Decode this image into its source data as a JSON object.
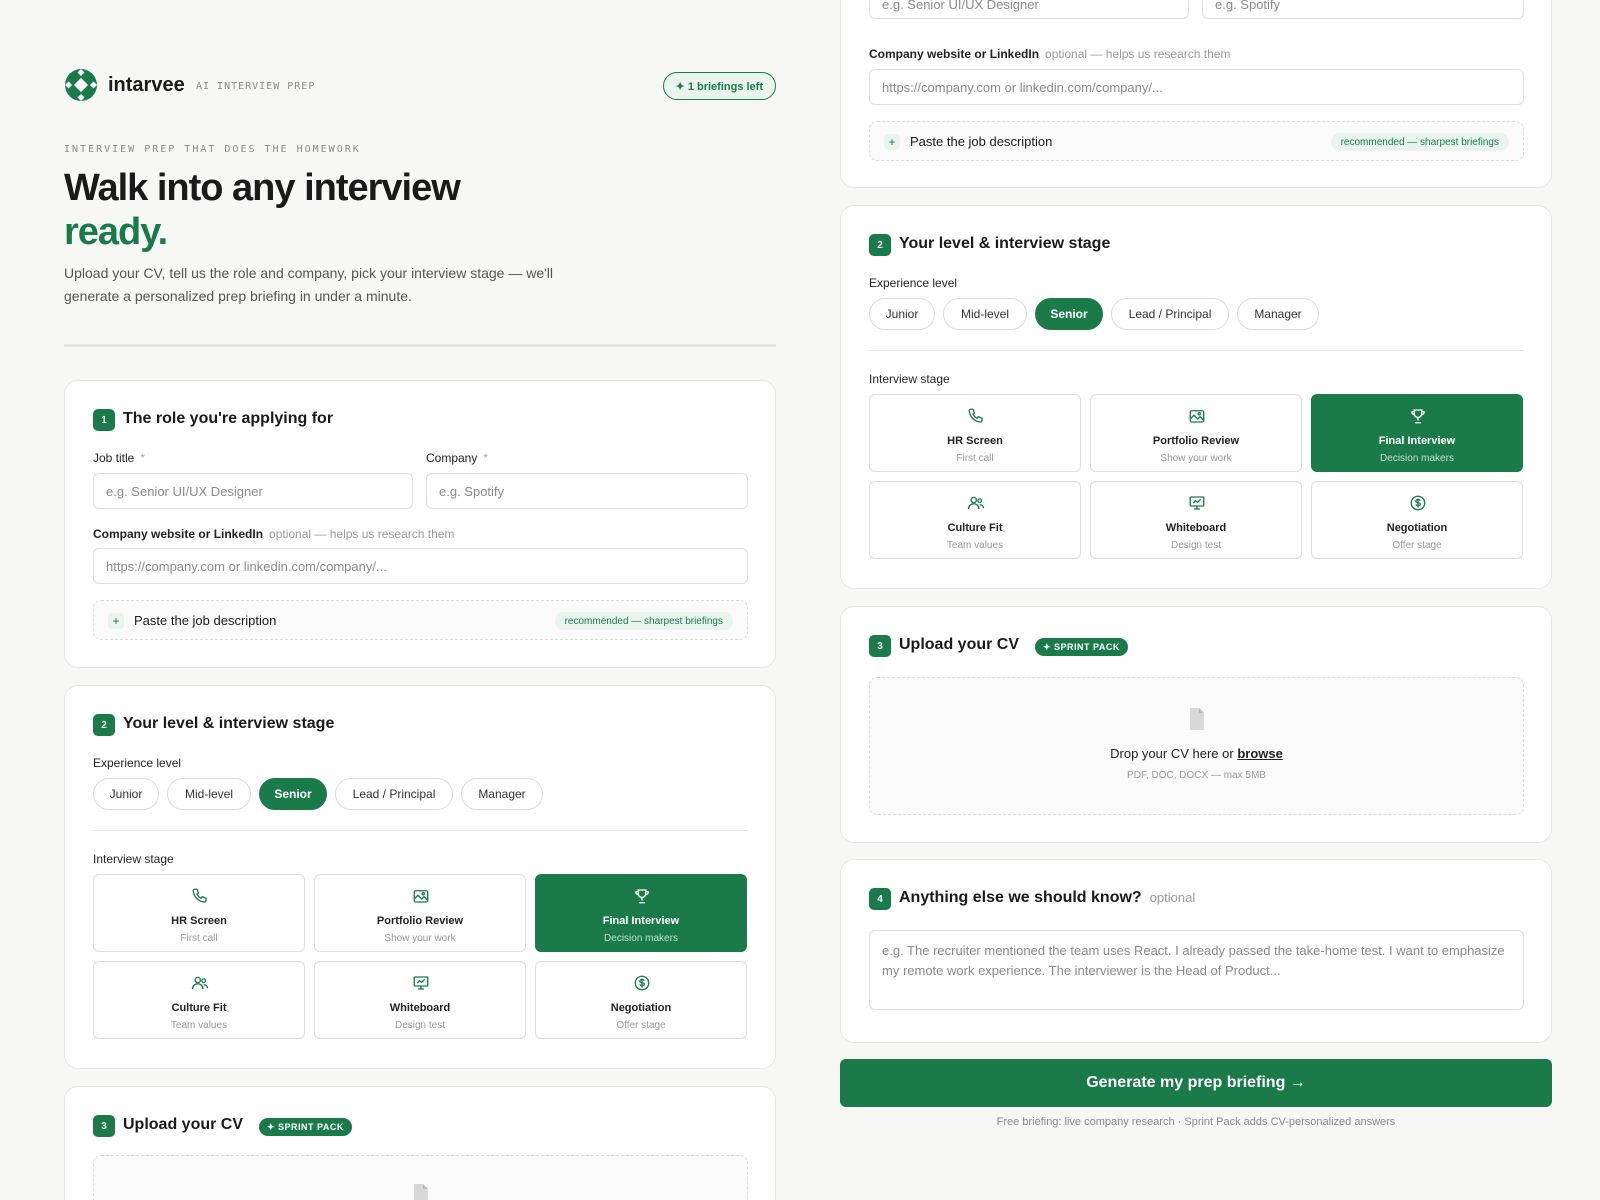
{
  "brand": {
    "name": "intarvee",
    "tag": "AI INTERVIEW PREP",
    "briefings_pill": "✦ 1 briefings left"
  },
  "hero": {
    "eyebrow": "INTERVIEW PREP THAT DOES THE HOMEWORK",
    "title_line1": "Walk into any interview",
    "title_line2": "ready.",
    "lede": "Upload your CV, tell us the role and company, pick your interview stage — we'll generate a personalized prep briefing in under a minute."
  },
  "role": {
    "step": "1",
    "title": "The role you're applying for",
    "job_title_label": "Job title",
    "job_title_placeholder": "e.g. Senior UI/UX Designer",
    "company_label": "Company",
    "company_placeholder": "e.g. Spotify",
    "required_mark": "*",
    "website_label": "Company website or LinkedIn",
    "website_hint": "optional — helps us research them",
    "website_placeholder": "https://company.com or linkedin.com/company/...",
    "jd_plus": "+",
    "jd_label": "Paste the job description",
    "jd_badge": "recommended — sharpest briefings"
  },
  "level": {
    "step": "2",
    "title": "Your level & interview stage",
    "experience_label": "Experience level",
    "levels": [
      "Junior",
      "Mid-level",
      "Senior",
      "Lead / Principal",
      "Manager"
    ],
    "selected_level": "Senior",
    "stage_label": "Interview stage",
    "stages": [
      {
        "title": "HR Screen",
        "sub": "First call",
        "icon": "phone-icon"
      },
      {
        "title": "Portfolio Review",
        "sub": "Show your work",
        "icon": "image-icon"
      },
      {
        "title": "Final Interview",
        "sub": "Decision makers",
        "icon": "trophy-icon"
      },
      {
        "title": "Culture Fit",
        "sub": "Team values",
        "icon": "users-icon"
      },
      {
        "title": "Whiteboard",
        "sub": "Design test",
        "icon": "presentation-icon"
      },
      {
        "title": "Negotiation",
        "sub": "Offer stage",
        "icon": "dollar-icon"
      }
    ],
    "selected_stage": "Final Interview"
  },
  "upload": {
    "step": "3",
    "title": "Upload your CV",
    "badge": "✦ SPRINT PACK",
    "drop_text": "Drop your CV here or",
    "browse": "browse",
    "formats": "PDF, DOC, DOCX — max 5MB"
  },
  "notes": {
    "step": "4",
    "title": "Anything else we should know?",
    "hint": "optional",
    "placeholder": "e.g. The recruiter mentioned the team uses React. I already passed the take-home test. I want to emphasize my remote work experience. The interviewer is the Head of Product..."
  },
  "cta": {
    "label": "Generate my prep briefing →",
    "footnote": "Free briefing: live company research · Sprint Pack adds CV-personalized answers"
  },
  "colors": {
    "accent": "#1a7a4a",
    "accent_light": "#e8f4ec",
    "background": "#f7f7f5"
  }
}
